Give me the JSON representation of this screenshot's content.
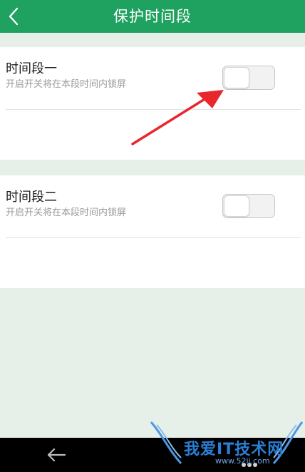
{
  "header": {
    "title": "保护时间段"
  },
  "periods": [
    {
      "name": "时间段一",
      "description": "开启开关将在本段时间内锁屏",
      "enabled": false
    },
    {
      "name": "时间段二",
      "description": "开启开关将在本段时间内锁屏",
      "enabled": false
    }
  ],
  "watermark": {
    "text": "我爱IT技术网",
    "url": "www.52ij.com"
  },
  "colors": {
    "accent": "#1fa15f",
    "background": "#e7efe9",
    "annotation_arrow": "#e8262c"
  },
  "icons": {
    "back": "chevron-left-icon",
    "nav_back": "arrow-left-icon"
  }
}
